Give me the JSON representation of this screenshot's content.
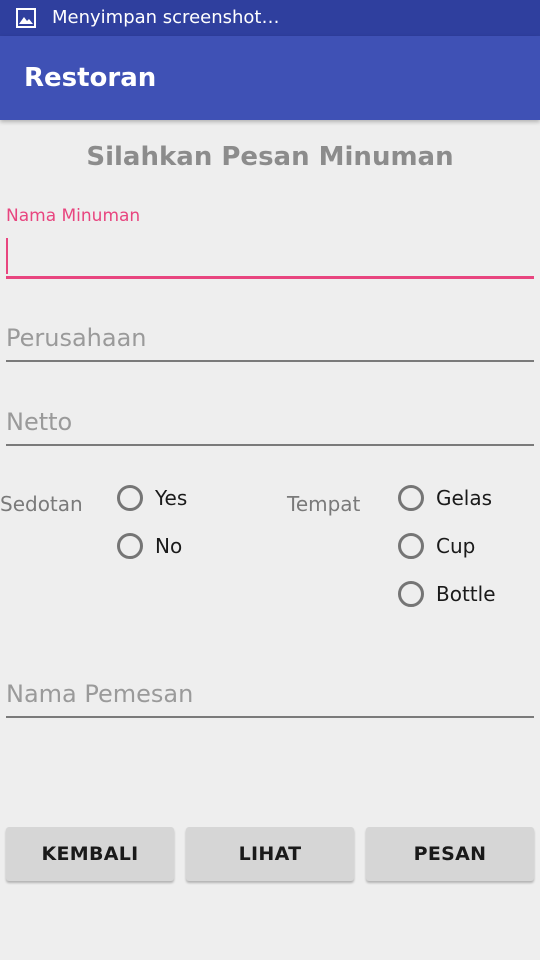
{
  "status_bar": {
    "icon": "image-icon",
    "text": "Menyimpan screenshot…"
  },
  "app_bar": {
    "title": "Restoran"
  },
  "form": {
    "heading": "Silahkan Pesan Minuman",
    "nama_minuman": {
      "label": "Nama Minuman",
      "value": ""
    },
    "perusahaan": {
      "placeholder": "Perusahaan",
      "value": ""
    },
    "netto": {
      "placeholder": "Netto",
      "value": ""
    },
    "sedotan": {
      "label": "Sedotan",
      "options": [
        "Yes",
        "No"
      ],
      "selected": null
    },
    "tempat": {
      "label": "Tempat",
      "options": [
        "Gelas",
        "Cup",
        "Bottle"
      ],
      "selected": null
    },
    "nama_pemesan": {
      "placeholder": "Nama Pemesan",
      "value": ""
    }
  },
  "buttons": {
    "kembali": "KEMBALI",
    "lihat": "LIHAT",
    "pesan": "PESAN"
  },
  "colors": {
    "status_bar": "#2f3f9e",
    "app_bar": "#3f51b5",
    "accent": "#e8457f",
    "background": "#eeeeee",
    "button": "#d6d6d6"
  }
}
